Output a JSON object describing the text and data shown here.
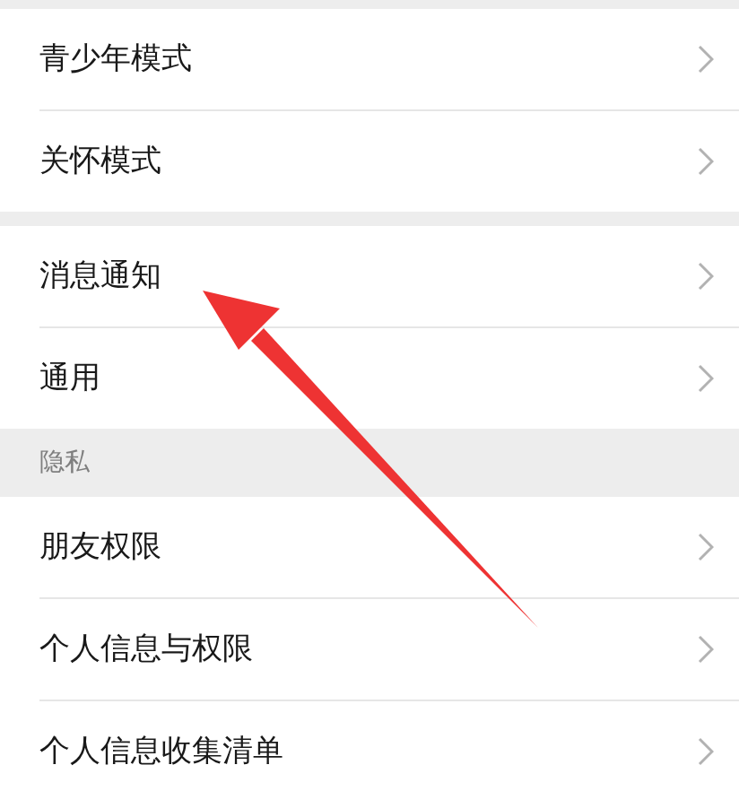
{
  "groups": [
    {
      "items": [
        {
          "label": "青少年模式"
        },
        {
          "label": "关怀模式"
        }
      ]
    },
    {
      "items": [
        {
          "label": "消息通知"
        },
        {
          "label": "通用"
        }
      ]
    },
    {
      "title": "隐私",
      "items": [
        {
          "label": "朋友权限"
        },
        {
          "label": "个人信息与权限"
        },
        {
          "label": "个人信息收集清单"
        }
      ]
    }
  ],
  "annotation": {
    "kind": "arrow",
    "color": "#ee3333"
  }
}
